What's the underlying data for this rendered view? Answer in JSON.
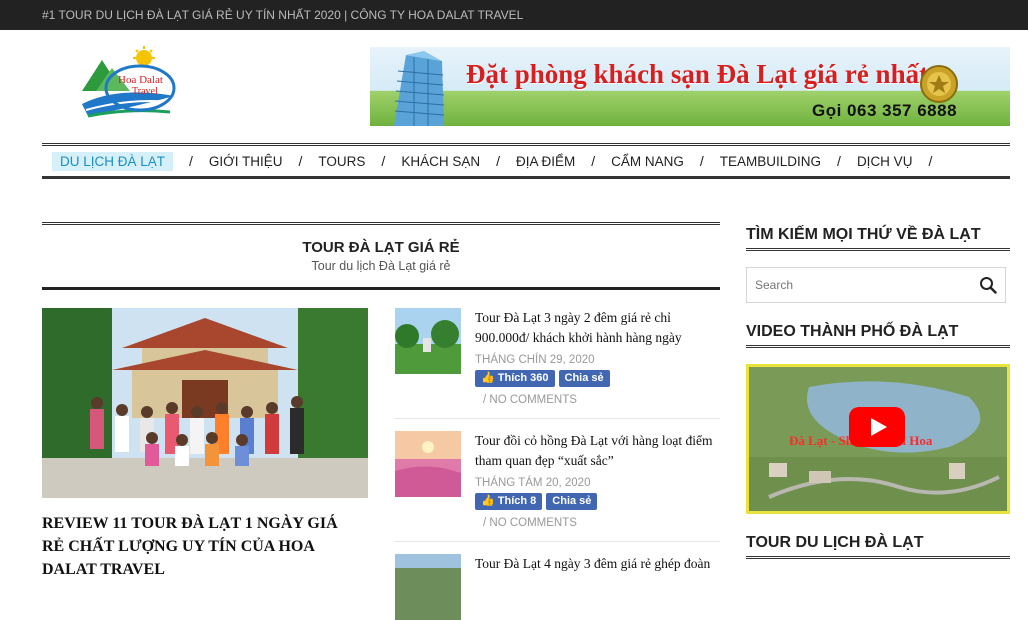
{
  "topbar": {
    "text": "#1 TOUR DU LỊCH ĐÀ LẠT GIÁ RẺ UY TÍN NHẤT 2020 | CÔNG TY HOA DALAT TRAVEL"
  },
  "logo": {
    "line1": "Hoa Dalat",
    "line2": "Travel"
  },
  "banner": {
    "title": "Đặt phòng khách sạn Đà Lạt giá rẻ nhất",
    "phone": "Gọi 063 357 6888"
  },
  "nav": {
    "items": [
      {
        "label": "DU LỊCH ĐÀ LẠT",
        "active": true
      },
      {
        "label": "GIỚI THIỆU"
      },
      {
        "label": "TOURS"
      },
      {
        "label": "KHÁCH SẠN"
      },
      {
        "label": "ĐỊA ĐIỂM"
      },
      {
        "label": "CẨM NANG"
      },
      {
        "label": "TEAMBUILDING"
      },
      {
        "label": "DỊCH VỤ"
      }
    ],
    "separator": "/"
  },
  "category": {
    "title": "TOUR ĐÀ LẠT GIÁ RẺ",
    "subtitle": "Tour du lịch Đà Lạt giá rẻ"
  },
  "featured": {
    "title": "REVIEW 11 TOUR ĐÀ LẠT 1 NGÀY GIÁ RẺ CHẤT LƯỢNG UY TÍN CỦA HOA DALAT TRAVEL"
  },
  "posts": [
    {
      "title": "Tour Đà Lạt 3 ngày 2 đêm giá rẻ chỉ 900.000đ/ khách khởi hành hàng ngày",
      "date": "THÁNG CHÍN 29, 2020",
      "like": "Thích 360",
      "share": "Chia sẻ",
      "comments": "/   NO COMMENTS"
    },
    {
      "title": "Tour đồi cỏ hồng Đà Lạt với hàng loạt điểm tham quan đẹp “xuất sắc”",
      "date": "THÁNG TÁM 20, 2020",
      "like": "Thích 8",
      "share": "Chia sẻ",
      "comments": "/   NO COMMENTS"
    },
    {
      "title": "Tour Đà Lạt 4 ngày 3 đêm giá rẻ ghép đoàn"
    }
  ],
  "sidebar": {
    "search_heading": "TÌM KIẾM MỌI THỨ VỀ ĐÀ LẠT",
    "search_placeholder": "Search",
    "video_heading": "VIDEO THÀNH PHỐ ĐÀ LẠT",
    "video_overlay": "Đà Lạt - Sha          Festival Hoa",
    "tour_heading": "TOUR DU LỊCH ĐÀ LẠT"
  },
  "colors": {
    "accent": "#1a8fc3",
    "facebook": "#4267b2",
    "topbar": "#222222"
  }
}
